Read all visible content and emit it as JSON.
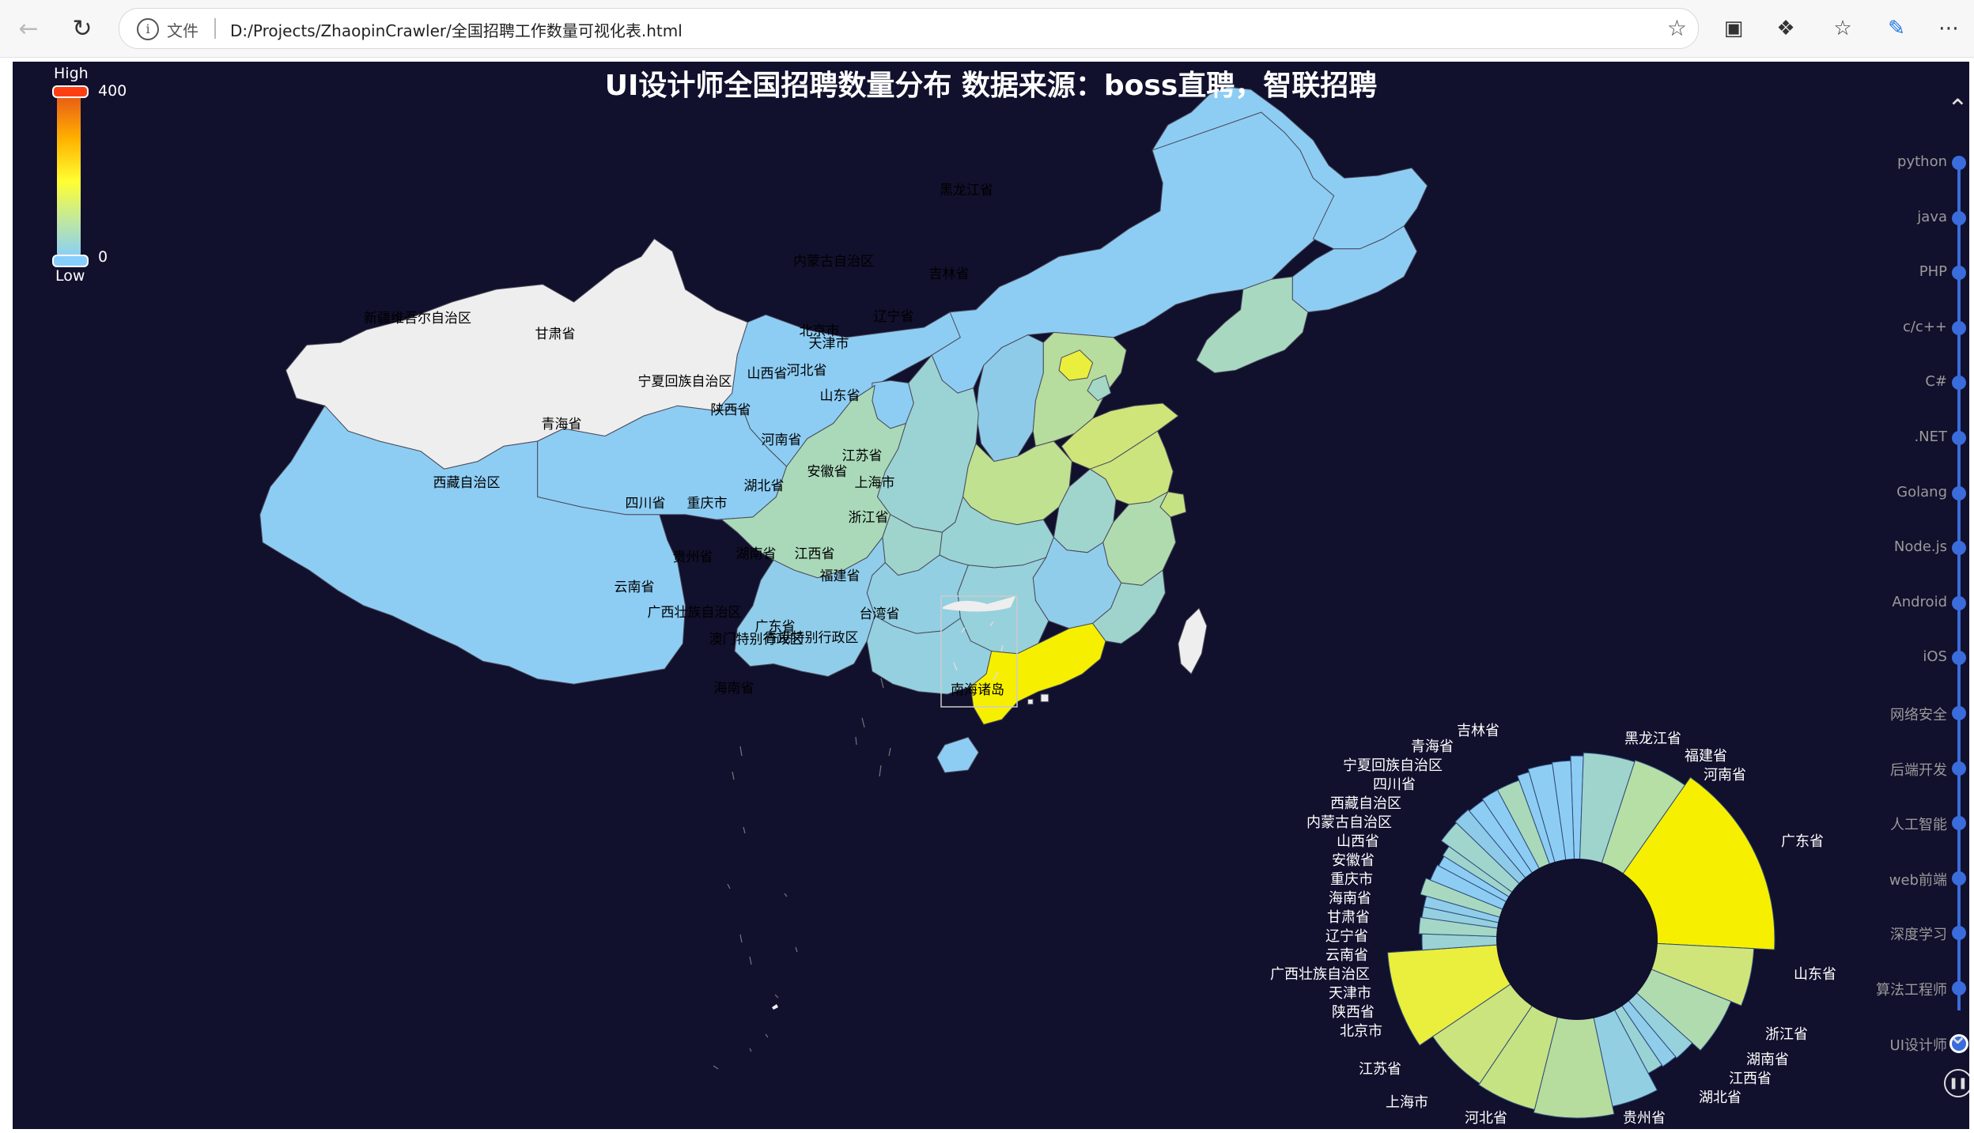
{
  "browser": {
    "file_label": "文件",
    "url": "D:/Projects/ZhaopinCrawler/全国招聘工作数量可视化表.html"
  },
  "chart_title": "UI设计师全国招聘数量分布 数据来源：boss直聘，智联招聘",
  "visual_map": {
    "high": "High",
    "low": "Low",
    "max": "400",
    "min": "0"
  },
  "colors": {
    "background": "#11102d",
    "timeline": "#3a6cdc"
  },
  "chart_data": {
    "type": "map",
    "visual_map_range": [
      0,
      400
    ],
    "provinces": [
      {
        "name": "新疆维吾尔自治区",
        "fill": "#eeeeee"
      },
      {
        "name": "西藏自治区",
        "fill": "#8dcdf4"
      },
      {
        "name": "青海省",
        "fill": "#8dcdf4"
      },
      {
        "name": "甘肃省",
        "fill": "#8dcdf4"
      },
      {
        "name": "内蒙古自治区",
        "fill": "#8dcdf4"
      },
      {
        "name": "黑龙江省",
        "fill": "#8dcdf4"
      },
      {
        "name": "吉林省",
        "fill": "#8dcdf4"
      },
      {
        "name": "辽宁省",
        "fill": "#a8d9c0"
      },
      {
        "name": "宁夏回族自治区",
        "fill": "#8dcdf4"
      },
      {
        "name": "山西省",
        "fill": "#8ecbe8"
      },
      {
        "name": "陕西省",
        "fill": "#9bd3d4"
      },
      {
        "name": "河北省",
        "fill": "#b6dc9e"
      },
      {
        "name": "北京市",
        "fill": "#eaee3c"
      },
      {
        "name": "天津市",
        "fill": "#a4d7c6"
      },
      {
        "name": "山东省",
        "fill": "#cfe579"
      },
      {
        "name": "河南省",
        "fill": "#bfe190"
      },
      {
        "name": "四川省",
        "fill": "#a9d9b9"
      },
      {
        "name": "重庆市",
        "fill": "#9fd4cd"
      },
      {
        "name": "湖北省",
        "fill": "#9ad3d4"
      },
      {
        "name": "安徽省",
        "fill": "#9fd5cd"
      },
      {
        "name": "江苏省",
        "fill": "#cbe47e"
      },
      {
        "name": "上海市",
        "fill": "#c6e384"
      },
      {
        "name": "浙江省",
        "fill": "#b0dbae"
      },
      {
        "name": "江西省",
        "fill": "#8fcdeb"
      },
      {
        "name": "湖南省",
        "fill": "#96d1dc"
      },
      {
        "name": "贵州省",
        "fill": "#93cfe2"
      },
      {
        "name": "云南省",
        "fill": "#8fcdeb"
      },
      {
        "name": "广西壮族自治区",
        "fill": "#95d0e0"
      },
      {
        "name": "广东省",
        "fill": "#f6f000"
      },
      {
        "name": "福建省",
        "fill": "#9fd4cd"
      },
      {
        "name": "台湾省",
        "fill": "#eeeeee"
      },
      {
        "name": "海南省",
        "fill": "#8dcdf4"
      },
      {
        "name": "香港特别行政区",
        "fill": "#eeeeee"
      },
      {
        "name": "澳门特别行政区",
        "fill": "#eeeeee"
      },
      {
        "name": "南海诸岛",
        "fill": "#eeeeee"
      }
    ],
    "pie": {
      "type": "pie (rose)",
      "slices": [
        {
          "name": "黑龙江省",
          "fill": "#8dcdf4"
        },
        {
          "name": "福建省",
          "fill": "#9fd4cd"
        },
        {
          "name": "河南省",
          "fill": "#b6dfa6"
        },
        {
          "name": "广东省",
          "fill": "#f6f000"
        },
        {
          "name": "山东省",
          "fill": "#cfe579"
        },
        {
          "name": "浙江省",
          "fill": "#b0dbae"
        },
        {
          "name": "湖南省",
          "fill": "#96d1dc"
        },
        {
          "name": "江西省",
          "fill": "#8fcdeb"
        },
        {
          "name": "湖北省",
          "fill": "#9ad3d4"
        },
        {
          "name": "贵州省",
          "fill": "#93cfe2"
        },
        {
          "name": "河北省",
          "fill": "#b6dc9e"
        },
        {
          "name": "上海市",
          "fill": "#c6e384"
        },
        {
          "name": "江苏省",
          "fill": "#cbe47e"
        },
        {
          "name": "北京市",
          "fill": "#eaee3c"
        },
        {
          "name": "陕西省",
          "fill": "#9bd3d4"
        },
        {
          "name": "天津市",
          "fill": "#a4d7c6"
        },
        {
          "name": "广西壮族自治区",
          "fill": "#95d0e0"
        },
        {
          "name": "云南省",
          "fill": "#8fcdeb"
        },
        {
          "name": "辽宁省",
          "fill": "#a8d9c0"
        },
        {
          "name": "甘肃省",
          "fill": "#8dcdf4"
        },
        {
          "name": "海南省",
          "fill": "#8dcdf4"
        },
        {
          "name": "重庆市",
          "fill": "#9fd4cd"
        },
        {
          "name": "安徽省",
          "fill": "#9fd5cd"
        },
        {
          "name": "山西省",
          "fill": "#8ecbe8"
        },
        {
          "name": "内蒙古自治区",
          "fill": "#8dcdf4"
        },
        {
          "name": "西藏自治区",
          "fill": "#8dcdf4"
        },
        {
          "name": "四川省",
          "fill": "#a9d9b9"
        },
        {
          "name": "宁夏回族自治区",
          "fill": "#8dcdf4"
        },
        {
          "name": "青海省",
          "fill": "#8dcdf4"
        },
        {
          "name": "吉林省",
          "fill": "#8dcdf4"
        }
      ]
    }
  },
  "timeline": {
    "items": [
      "python",
      "java",
      "PHP",
      "c/c++",
      "C#",
      ".NET",
      "Golang",
      "Node.js",
      "Android",
      "iOS",
      "网络安全",
      "后端开发",
      "人工智能",
      "web前端",
      "深度学习",
      "算法工程师",
      "UI设计师"
    ],
    "selected": "UI设计师"
  }
}
